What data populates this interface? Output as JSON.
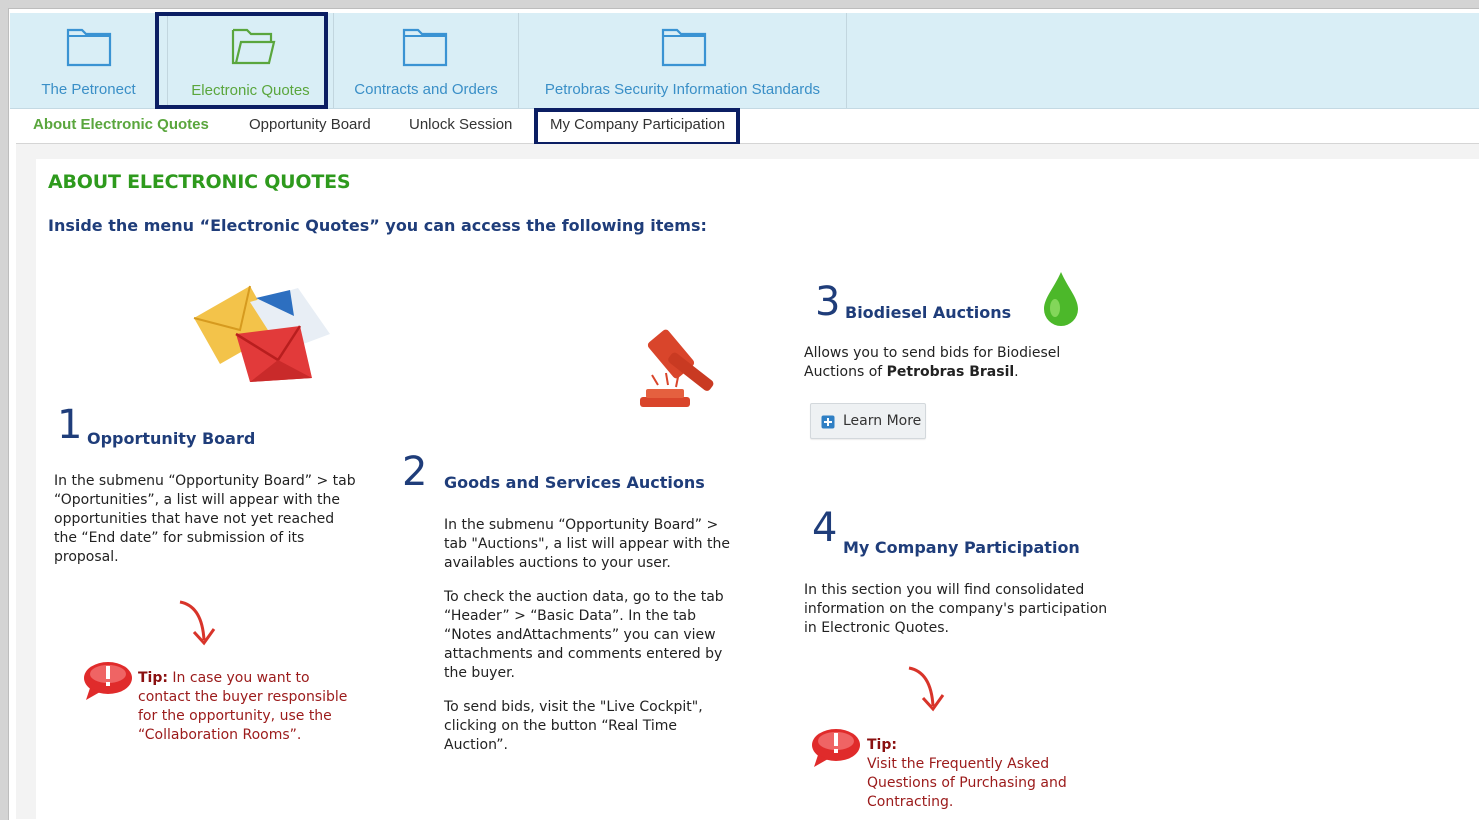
{
  "top_nav": {
    "items": [
      {
        "label": "The Petronect",
        "icon": "folder-icon"
      },
      {
        "label": "Electronic Quotes",
        "icon": "folder-open-icon",
        "active": true
      },
      {
        "label": "Contracts and Orders",
        "icon": "folder-icon"
      },
      {
        "label": "Petrobras Security Information Standards",
        "icon": "folder-icon"
      }
    ]
  },
  "sub_nav": {
    "items": [
      {
        "label": "About Electronic Quotes",
        "active": true
      },
      {
        "label": "Opportunity Board"
      },
      {
        "label": "Unlock Session"
      },
      {
        "label": "My Company Participation"
      }
    ]
  },
  "page": {
    "title": "ABOUT ELECTRONIC QUOTES",
    "intro": "Inside the menu “Electronic Quotes” you can access the following items:"
  },
  "sections": [
    {
      "number": "1",
      "title": "Opportunity Board",
      "paragraphs": [
        "In the submenu “Opportunity Board” > tab “Oportunities”, a list will appear with the opportunities that have not yet reached the “End date” for submission of its proposal."
      ],
      "tip_label": "Tip:",
      "tip_text": " In case you want to contact the buyer responsible for the opportunity, use the “Collaboration Rooms”.",
      "icon": "envelopes-icon"
    },
    {
      "number": "2",
      "title": "Goods and Services Auctions",
      "paragraphs": [
        "In the submenu “Opportunity Board” > tab \"Auctions\", a list will appear with the availables auctions to your user.",
        "To check the auction data, go to the tab “Header” > “Basic Data”. In the tab “Notes andAttachments” you can view attachments and comments entered by the buyer.",
        "To send bids, visit the \"Live Cockpit\", clicking on the button “Real Time Auction”."
      ],
      "icon": "gavel-icon"
    },
    {
      "number": "3",
      "title": "Biodiesel Auctions",
      "text_before": "Allows you to send bids for Biodiesel Auctions of ",
      "text_bold": "Petrobras Brasil",
      "text_after": ".",
      "button_label": "Learn More",
      "icon": "oil-drop-icon"
    },
    {
      "number": "4",
      "title": "My Company Participation",
      "paragraphs": [
        "In this section you will find consolidated information on the company's participation in Electronic Quotes."
      ],
      "tip_label": "Tip:",
      "tip_text": "Visit the Frequently Asked Questions of Purchasing and Contracting."
    }
  ],
  "colors": {
    "nav_bg": "#d9eef6",
    "nav_link": "#3a8fc7",
    "active_green": "#5aa63d",
    "title_green": "#2e9a1d",
    "heading_navy": "#1f3d7a",
    "highlight_box": "#0b1e63",
    "tip_red": "#9b1a1a"
  }
}
